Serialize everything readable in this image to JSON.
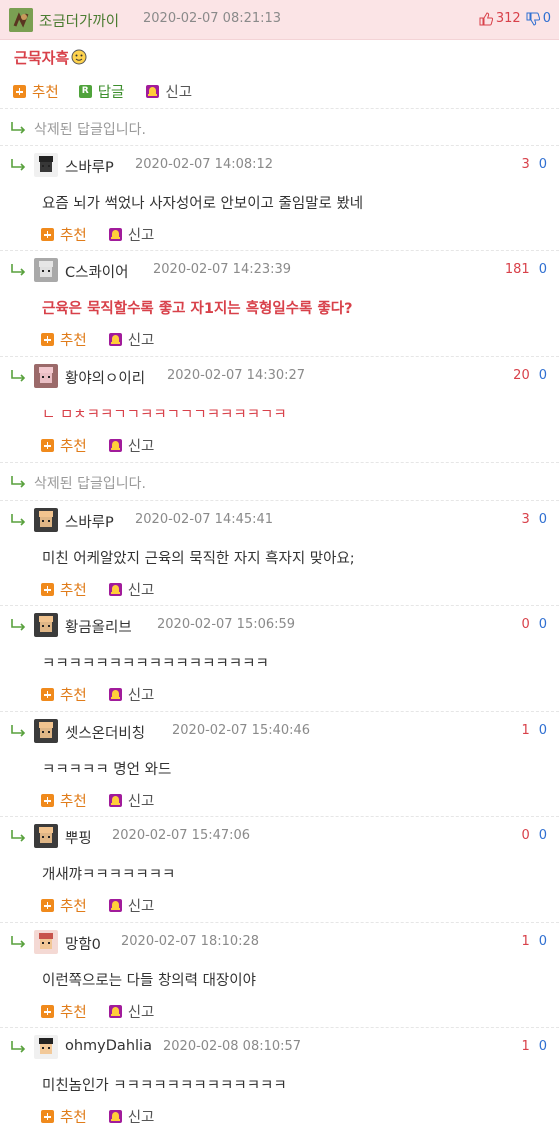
{
  "post": {
    "nick": "조금더가까이",
    "time": "2020-02-07 08:21:13",
    "up": "312",
    "down": "0",
    "text": "근묵자흑",
    "actions": {
      "recommend": "추천",
      "reply": "답글",
      "report": "신고"
    }
  },
  "replies": [
    {
      "deleted": true,
      "text": "삭제된 답글입니다."
    },
    {
      "nick": "스바루P",
      "time": "2020-02-07 14:08:12",
      "up": "3",
      "down": "0",
      "text": "요즘 뇌가 썩었나 사자성어로 안보이고 줄임말로 봤네"
    },
    {
      "nick": "C스콰이어",
      "time": "2020-02-07 14:23:39",
      "up": "181",
      "down": "0",
      "text": "근육은 묵직할수록 좋고 자1지는 흑형일수록 좋다?"
    },
    {
      "nick": "황야의ㅇ이리",
      "time": "2020-02-07 14:30:27",
      "up": "20",
      "down": "0",
      "text": "ㄴ ㅁㅊㅋㅋㄱㄱㅋㅋㄱㄱㄱㅋㅋㅋㅋㄱㅋ"
    },
    {
      "deleted": true,
      "text": "삭제된 답글입니다."
    },
    {
      "nick": "스바루P",
      "time": "2020-02-07 14:45:41",
      "up": "3",
      "down": "0",
      "text": "미친 어케알았지 근육의 묵직한 자지 흑자지 맞아요;"
    },
    {
      "nick": "황금올리브",
      "time": "2020-02-07 15:06:59",
      "up": "0",
      "down": "0",
      "text": "ㅋㅋㅋㅋㅋㅋㅋㅋㅋㅋㅋㅋㅋㅋㅋㅋㅋ"
    },
    {
      "nick": "셋스온더비칭",
      "time": "2020-02-07 15:40:46",
      "up": "1",
      "down": "0",
      "text": "ㅋㅋㅋㅋㅋ 명언 와드"
    },
    {
      "nick": "뿌핑",
      "time": "2020-02-07 15:47:06",
      "up": "0",
      "down": "0",
      "text": "개새꺄ㅋㅋㅋㅋㅋㅋㅋ"
    },
    {
      "nick": "망함0",
      "time": "2020-02-07 18:10:28",
      "up": "1",
      "down": "0",
      "text": "이런쪽으로는 다들 창의력 대장이야"
    },
    {
      "nick": "ohmyDahlia",
      "time": "2020-02-08 08:10:57",
      "up": "1",
      "down": "0",
      "text": "미친놈인가 ㅋㅋㅋㅋㅋㅋㅋㅋㅋㅋㅋㅋㅋ"
    }
  ],
  "labels": {
    "recommend": "추천",
    "report": "신고"
  },
  "colors": {
    "accent_red": "#d8414a",
    "accent_blue": "#2f6fd1",
    "recommend_orange": "#e07c1a",
    "header_bg": "#fbe4e6"
  },
  "icons": {
    "up": "thumbs-up-icon",
    "down": "thumbs-down-icon",
    "recommend": "plus-icon",
    "reply": "reply-r-icon",
    "report": "siren-icon",
    "arrow": "reply-arrow-icon"
  }
}
